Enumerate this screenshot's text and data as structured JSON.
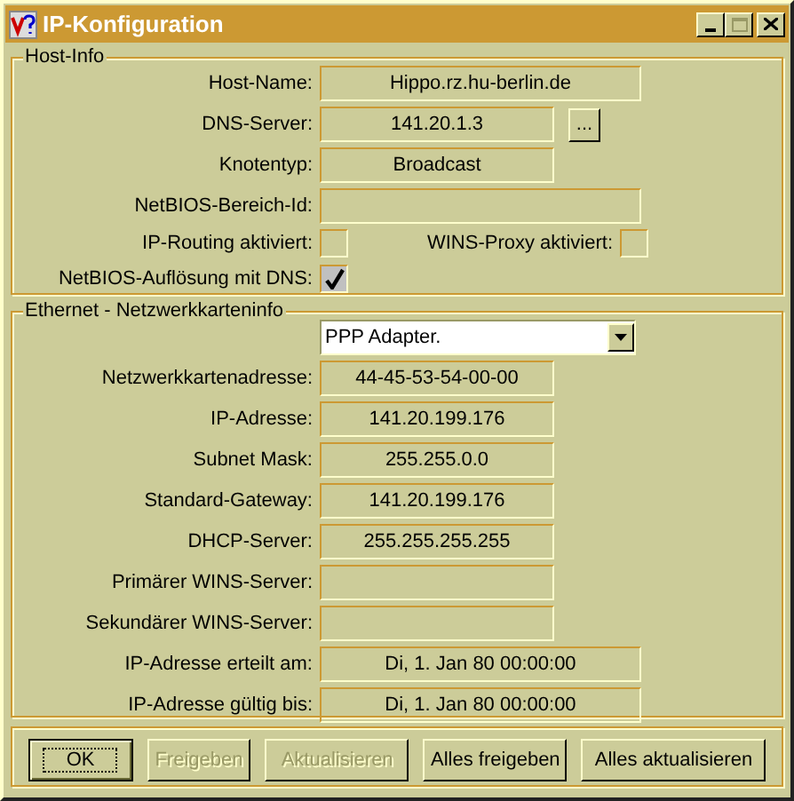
{
  "window": {
    "title": "IP-Konfiguration"
  },
  "host_info": {
    "title": "Host-Info",
    "fields": [
      {
        "label": "Host-Name:",
        "value": "Hippo.rz.hu-berlin.de",
        "kind": "long"
      },
      {
        "label": "DNS-Server:",
        "value": "141.20.1.3",
        "kind": "short",
        "button": "..."
      },
      {
        "label": "Knotentyp:",
        "value": "Broadcast",
        "kind": "short"
      },
      {
        "label": "NetBIOS-Bereich-Id:",
        "kind": "long"
      }
    ],
    "checkboxes": [
      {
        "label": "IP-Routing aktiviert:",
        "checked": false
      },
      {
        "label": "WINS-Proxy aktiviert:",
        "checked": false
      },
      {
        "label": "NetBIOS-Auflösung mit DNS:",
        "checked": true
      }
    ]
  },
  "adapter_info": {
    "title": "Ethernet - Netzwerkkarteninfo",
    "adapter": "PPP Adapter.",
    "fields": [
      {
        "label": "Netzwerkkartenadresse:",
        "value": "44-45-53-54-00-00",
        "kind": "short"
      },
      {
        "label": "IP-Adresse:",
        "value": "141.20.199.176",
        "kind": "short"
      },
      {
        "label": "Subnet Mask:",
        "value": "255.255.0.0",
        "kind": "short"
      },
      {
        "label": "Standard-Gateway:",
        "value": "141.20.199.176",
        "kind": "short"
      },
      {
        "label": "DHCP-Server:",
        "value": "255.255.255.255",
        "kind": "short"
      },
      {
        "label": "Primärer WINS-Server:",
        "kind": "short"
      },
      {
        "label": "Sekundärer WINS-Server:",
        "kind": "short"
      },
      {
        "label": "IP-Adresse erteilt am:",
        "value": "Di, 1. Jan 80 00:00:00",
        "kind": "long"
      },
      {
        "label": "IP-Adresse gültig bis:",
        "value": "Di, 1. Jan 80 00:00:00",
        "kind": "long"
      }
    ]
  },
  "buttons": [
    {
      "label": "OK",
      "disabled": false,
      "default": true
    },
    {
      "label": "Freigeben",
      "disabled": true,
      "default": false
    },
    {
      "label": "Aktualisieren",
      "disabled": true,
      "default": false
    },
    {
      "label": "Alles freigeben",
      "disabled": false,
      "default": false
    },
    {
      "label": "Alles aktualisieren",
      "disabled": false,
      "default": false
    }
  ]
}
